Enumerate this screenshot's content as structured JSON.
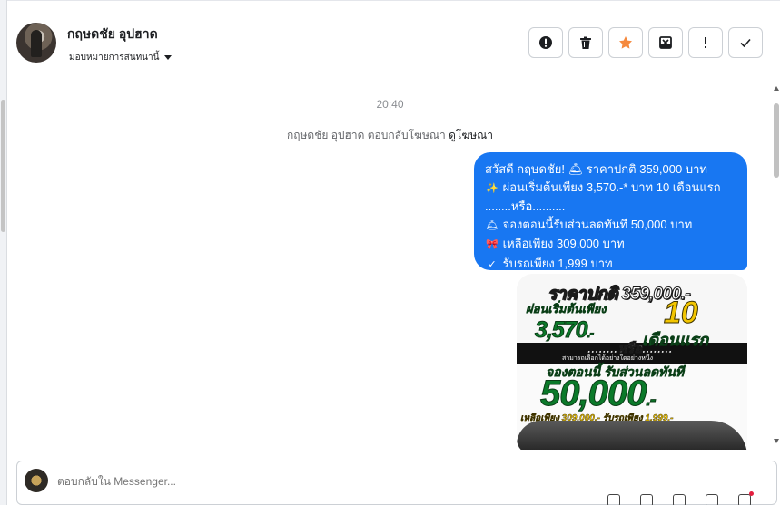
{
  "header": {
    "contact_name": "กฤษดชัย อุปฮาด",
    "assign_label": "มอบหมายการสนทนานี้",
    "actions": [
      {
        "name": "report-spam",
        "icon": "alert-circle-icon"
      },
      {
        "name": "delete",
        "icon": "trash-icon"
      },
      {
        "name": "star",
        "icon": "star-icon",
        "color": "#f5893d"
      },
      {
        "name": "move-to-folder",
        "icon": "inbox-x-icon"
      },
      {
        "name": "mark-important",
        "icon": "exclamation-icon"
      },
      {
        "name": "mark-done",
        "icon": "check-icon"
      }
    ]
  },
  "conversation": {
    "timestamp": "20:40",
    "notice_text": "กฤษดชัย อุปฮาด ตอบกลับโฆษณา",
    "notice_link": "ดูโฆษณา",
    "message_lines": [
      {
        "emoji": "🛎",
        "text": "สวัสดี กฤษดชัย! 🛎  ราคาปกติ 359,000 บาท"
      },
      {
        "emoji": "✨",
        "text": "ผ่อนเริ่มต้นเพียง 3,570.-* บาท 10 เดือนแรก"
      },
      {
        "emoji": "",
        "text": "........หรือ.........."
      },
      {
        "emoji": "🛎",
        "text": "จองตอนนี้รับส่วนลดทันที 50,000 บาท"
      },
      {
        "emoji": "🎀",
        "text": "เหลือเพียง 309,000 บาท"
      },
      {
        "emoji": "✓",
        "text": "รับรถเพียง 1,999 บาท"
      }
    ],
    "image_ad": {
      "headline": "ราคาปกติ 359,000.-",
      "installment_label": "ผ่อนเริ่มต้นเพียง",
      "installment_amount": "3,570",
      "installment_suffix": ".-",
      "months_number": "10",
      "months_label": "เดือนแรก",
      "or_label": "........หรือ........",
      "fine_print": "สามารถเลือกได้อย่างใดอย่างหนึ่ง",
      "discount_label": "จองตอนนี้ รับส่วนลดทันที",
      "discount_amount": "50,000",
      "discount_suffix": ".-",
      "remaining_label": "เหลือเพียง 309,000.- รับรถเพียง 1,999.-"
    }
  },
  "composer": {
    "placeholder": "ตอบกลับใน Messenger..."
  }
}
